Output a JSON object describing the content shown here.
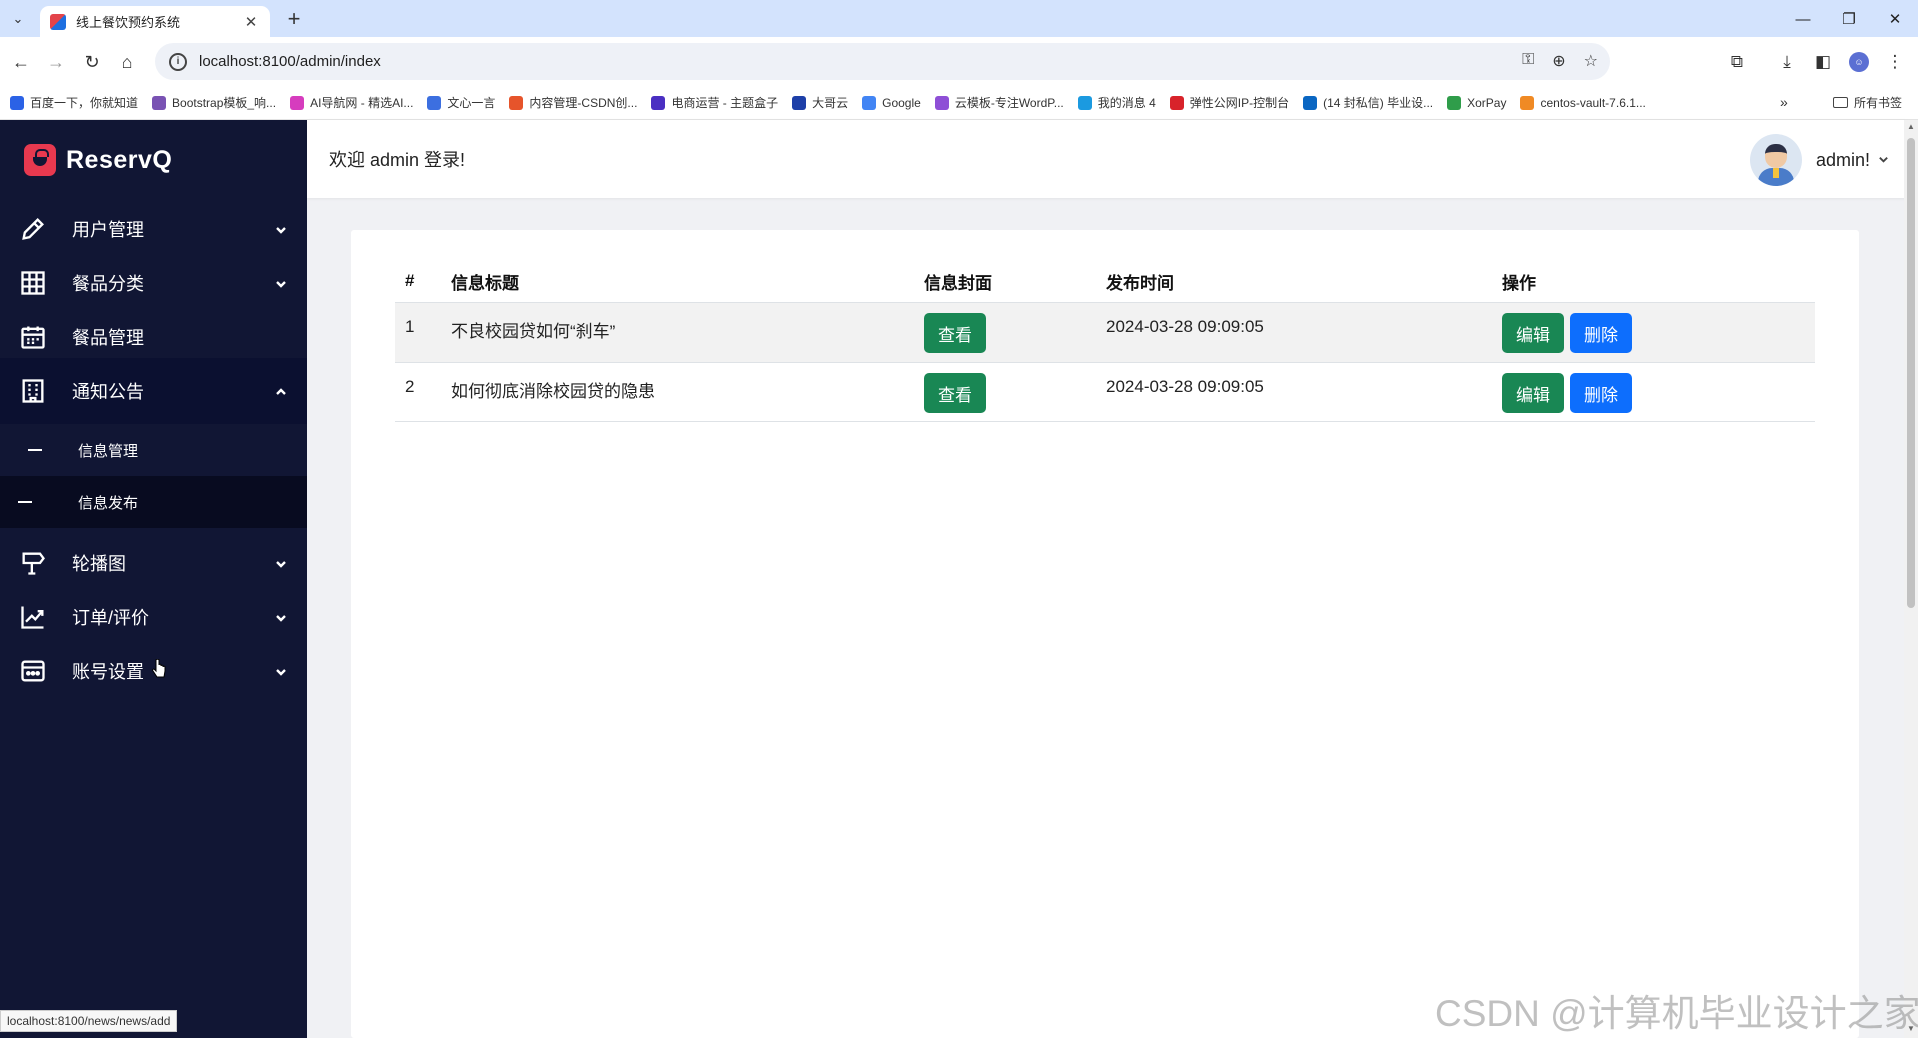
{
  "browser": {
    "tab_title": "线上餐饮预约系统",
    "url": "localhost:8100/admin/index",
    "status_url": "localhost:8100/news/news/add",
    "bookmarks": [
      {
        "label": "百度一下，你就知道",
        "color": "#2b62e6"
      },
      {
        "label": "Bootstrap模板_响...",
        "color": "#7952b3"
      },
      {
        "label": "AI导航网 - 精选AI...",
        "color": "#d63cbe"
      },
      {
        "label": "文心一言",
        "color": "#3c6fe0"
      },
      {
        "label": "内容管理-CSDN创...",
        "color": "#e6542b"
      },
      {
        "label": "电商运营 - 主题盒子",
        "color": "#4a2fc2"
      },
      {
        "label": "大哥云",
        "color": "#1d3fa8"
      },
      {
        "label": "Google",
        "color": "#4285f4"
      },
      {
        "label": "云模板-专注WordP...",
        "color": "#8e4fd6"
      },
      {
        "label": "我的消息 4",
        "color": "#1b9ae0"
      },
      {
        "label": "弹性公网IP-控制台",
        "color": "#d8232a"
      },
      {
        "label": "(14 封私信) 毕业设...",
        "color": "#0a66c2"
      },
      {
        "label": "XorPay",
        "color": "#2f9d4a"
      },
      {
        "label": "centos-vault-7.6.1...",
        "color": "#f08a24"
      }
    ],
    "all_bookmarks": "所有书签"
  },
  "sidebar": {
    "brand": "ReservQ",
    "menu": [
      {
        "label": "用户管理",
        "icon": "pencil-icon"
      },
      {
        "label": "餐品分类",
        "icon": "grid-icon"
      },
      {
        "label": "餐品管理",
        "icon": "calendar-icon"
      },
      {
        "label": "通知公告",
        "icon": "building-icon"
      },
      {
        "label": "轮播图",
        "icon": "signpost-icon"
      },
      {
        "label": "订单/评价",
        "icon": "chart-icon"
      },
      {
        "label": "账号设置",
        "icon": "card-icon"
      }
    ],
    "submenu": [
      {
        "label": "信息管理"
      },
      {
        "label": "信息发布"
      }
    ]
  },
  "header": {
    "welcome": "欢迎 admin 登录!",
    "username": "admin!"
  },
  "table": {
    "headers": [
      "#",
      "信息标题",
      "信息封面",
      "发布时间",
      "操作"
    ],
    "rows": [
      {
        "id": "1",
        "title": "不良校园贷如何“刹车”",
        "cover_btn": "查看",
        "time": "2024-03-28 09:09:05",
        "edit": "编辑",
        "delete": "删除"
      },
      {
        "id": "2",
        "title": "如何彻底消除校园贷的隐患",
        "cover_btn": "查看",
        "time": "2024-03-28 09:09:05",
        "edit": "编辑",
        "delete": "删除"
      }
    ]
  },
  "watermark": "CSDN @计算机毕业设计之家",
  "colors": {
    "sidebar_bg": "#111634",
    "brand_accent": "#e8394f",
    "btn_green": "#198754",
    "btn_blue": "#0d6efd"
  }
}
